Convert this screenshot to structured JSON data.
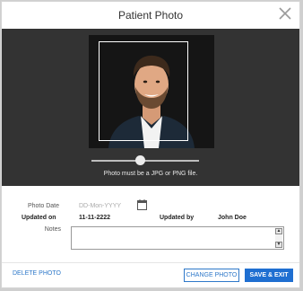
{
  "dialog": {
    "title": "Patient Photo"
  },
  "photo": {
    "hint": "Photo must be a JPG or PNG file.",
    "zoom_level": 0.45
  },
  "form": {
    "photo_date_label": "Photo Date",
    "photo_date_placeholder": "DD-Mon-YYYY",
    "updated_on_label": "Updated on",
    "updated_on_value": "11-11-2222",
    "updated_by_label": "Updated by",
    "updated_by_value": "John Doe",
    "notes_label": "Notes",
    "notes_value": ""
  },
  "footer": {
    "delete_label": "DELETE PHOTO",
    "change_label": "CHANGE PHOTO",
    "save_label": "SAVE & EXIT"
  },
  "colors": {
    "accent": "#1f6fd1",
    "dark_panel": "#333333"
  },
  "icons": {
    "close": "close-icon",
    "calendar": "calendar-icon"
  }
}
